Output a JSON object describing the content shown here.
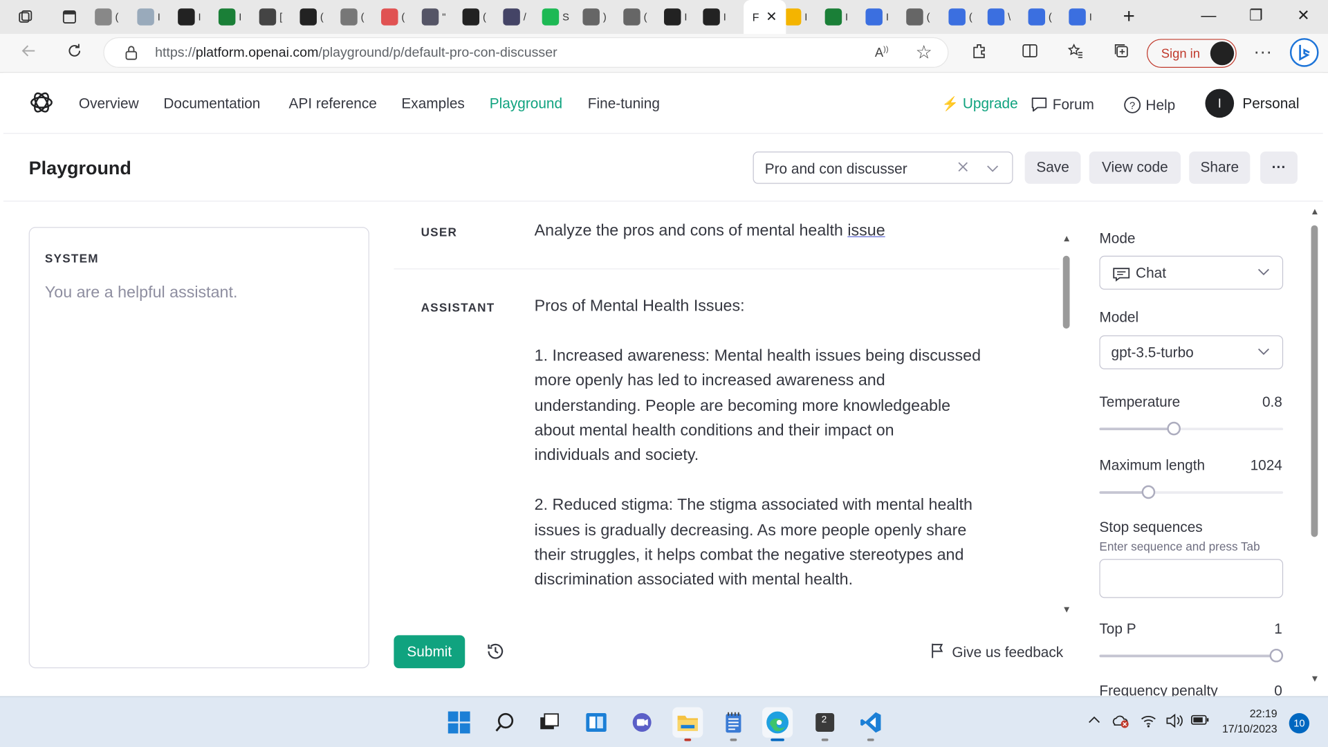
{
  "browser": {
    "url_prefix": "https://",
    "url_domain": "platform.openai.com",
    "url_path": "/playground/p/default-pro-con-discusser",
    "active_tab_label": "F",
    "signin_label": "Sign in",
    "tab_labels": [
      "(",
      "I",
      "I",
      "I",
      "[",
      "(",
      "(",
      "(",
      "\"",
      "(",
      "/",
      "S",
      ")",
      "(",
      "I",
      "I",
      "I",
      "I",
      "I",
      "(",
      "(",
      "\\",
      "(",
      "I"
    ]
  },
  "nav": {
    "links": [
      "Overview",
      "Documentation",
      "API reference",
      "Examples",
      "Playground",
      "Fine-tuning"
    ],
    "active": "Playground",
    "upgrade": "Upgrade",
    "forum": "Forum",
    "help": "Help",
    "avatar_initial": "I",
    "account": "Personal"
  },
  "header": {
    "title": "Playground",
    "preset": "Pro and con discusser",
    "save": "Save",
    "view_code": "View code",
    "share": "Share",
    "more": "···"
  },
  "system": {
    "label": "SYSTEM",
    "text": "You are a helpful assistant."
  },
  "messages": {
    "user_role": "USER",
    "user_text_before": "Analyze the pros and cons of mental health ",
    "user_text_underlined": "issue",
    "assistant_role": "ASSISTANT",
    "assistant_heading": "Pros of Mental Health Issues:",
    "assistant_points": [
      [
        "1. Increased awareness: Mental health issues being discussed",
        "more openly has led to increased awareness and",
        "understanding. People are becoming more knowledgeable",
        "about mental health conditions and their impact on",
        "individuals and society."
      ],
      [
        "2. Reduced stigma: The stigma associated with mental health",
        "issues is gradually decreasing. As more people openly share",
        "their struggles, it helps combat the negative stereotypes and",
        "discrimination associated with mental health."
      ]
    ]
  },
  "actions": {
    "submit": "Submit",
    "feedback": "Give us feedback"
  },
  "settings": {
    "mode_label": "Mode",
    "mode_value": "Chat",
    "model_label": "Model",
    "model_value": "gpt-3.5-turbo",
    "temperature_label": "Temperature",
    "temperature_value": "0.8",
    "temperature_fraction": 0.4,
    "max_length_label": "Maximum length",
    "max_length_value": "1024",
    "max_length_fraction": 0.25,
    "stop_label": "Stop sequences",
    "stop_hint": "Enter sequence and press Tab",
    "top_p_label": "Top P",
    "top_p_value": "1",
    "top_p_fraction": 1.0,
    "freq_label": "Frequency penalty",
    "freq_value": "0"
  },
  "taskbar": {
    "time": "22:19",
    "date": "17/10/2023",
    "notifications": "10",
    "terminal_badge": "2"
  },
  "colors": {
    "accent": "#10a37f",
    "signin": "#c0392b"
  }
}
